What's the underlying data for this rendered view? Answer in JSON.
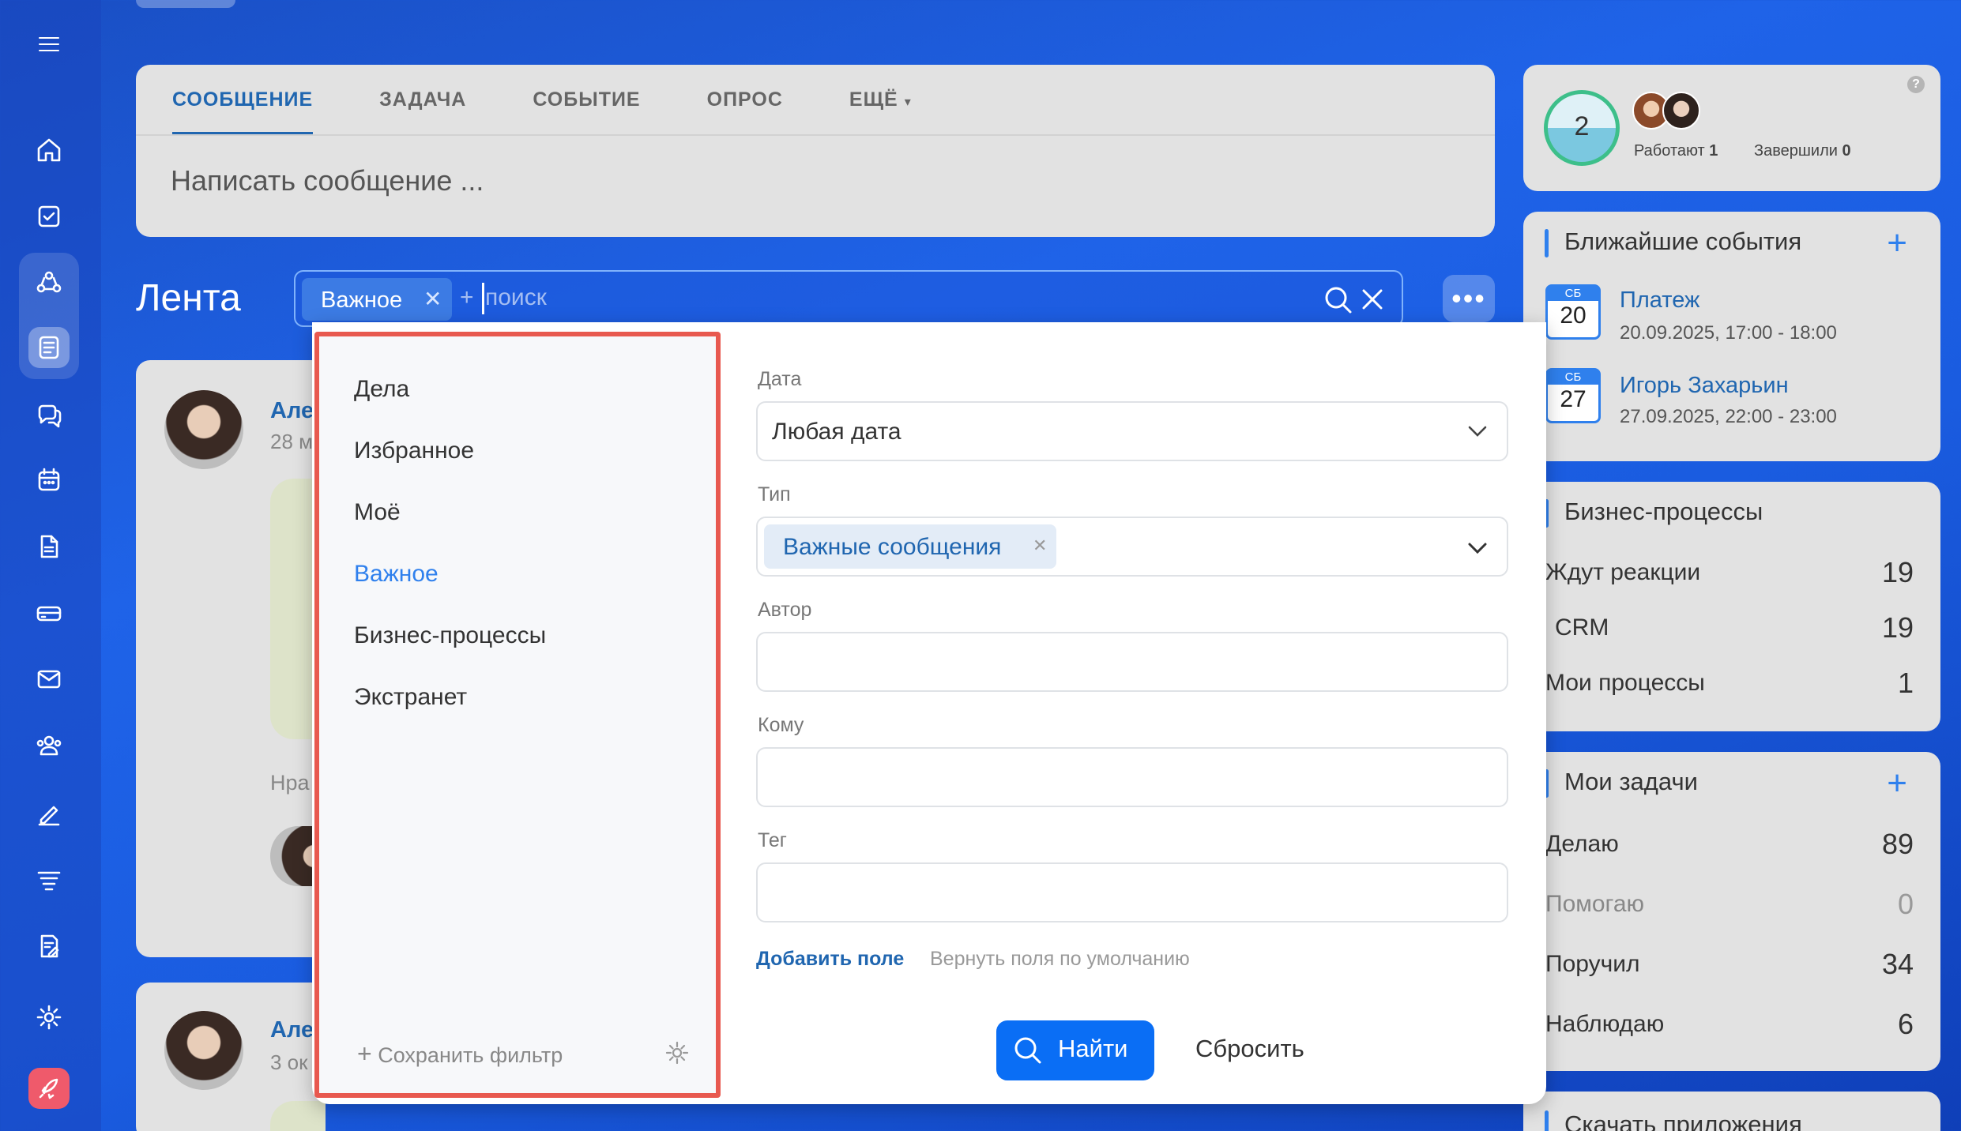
{
  "composer": {
    "tabs": [
      {
        "label": "СООБЩЕНИЕ"
      },
      {
        "label": "ЗАДАЧА"
      },
      {
        "label": "СОБЫТИЕ"
      },
      {
        "label": "ОПРОС"
      },
      {
        "label": "ЕЩЁ"
      }
    ],
    "placeholder": "Написать сообщение ..."
  },
  "feed": {
    "title": "Лента",
    "search": {
      "chip": "Важное",
      "plus": "+",
      "placeholder": "поиск"
    },
    "posts": [
      {
        "author_partial": "Але",
        "date_partial": "28 м",
        "likes_partial": "Нра"
      },
      {
        "author_partial": "Але",
        "date_partial": "3 ок"
      }
    ]
  },
  "filter": {
    "presets": [
      {
        "label": "Дела"
      },
      {
        "label": "Избранное"
      },
      {
        "label": "Моё"
      },
      {
        "label": "Важное"
      },
      {
        "label": "Бизнес-процессы"
      },
      {
        "label": "Экстранет"
      }
    ],
    "save_filter": "Сохранить фильтр",
    "fields": {
      "date_label": "Дата",
      "date_value": "Любая дата",
      "type_label": "Тип",
      "type_chip": "Важные сообщения",
      "author_label": "Автор",
      "to_label": "Кому",
      "tag_label": "Тег"
    },
    "add_field": "Добавить поле",
    "reset_fields": "Вернуть поля по умолчанию",
    "find_button": "Найти",
    "reset_button": "Сбросить"
  },
  "worktime": {
    "count": "2",
    "working_label": "Работают",
    "working_value": "1",
    "done_label": "Завершили",
    "done_value": "0"
  },
  "events": {
    "title": "Ближайшие события",
    "items": [
      {
        "weekday": "СБ",
        "day": "20",
        "name": "Платеж",
        "time": "20.09.2025, 17:00 - 18:00"
      },
      {
        "weekday": "СБ",
        "day": "27",
        "name": "Игорь Захарьин",
        "time": "27.09.2025, 22:00 - 23:00"
      }
    ]
  },
  "bp": {
    "title": "Бизнес-процессы",
    "rows": [
      {
        "label": "Ждут реакции",
        "value": "19"
      },
      {
        "label": "CRM",
        "value": "19"
      },
      {
        "label": "Мои процессы",
        "value": "1"
      }
    ]
  },
  "tasks": {
    "title": "Мои задачи",
    "rows": [
      {
        "label": "Делаю",
        "value": "89"
      },
      {
        "label": "Помогаю",
        "value": "0"
      },
      {
        "label": "Поручил",
        "value": "34"
      },
      {
        "label": "Наблюдаю",
        "value": "6"
      }
    ]
  },
  "apps": {
    "title": "Скачать приложения"
  },
  "colors": {
    "accent": "#2f80ed",
    "link": "#2066b0",
    "highlight": "#e8594f",
    "button": "#0a6ef5"
  }
}
